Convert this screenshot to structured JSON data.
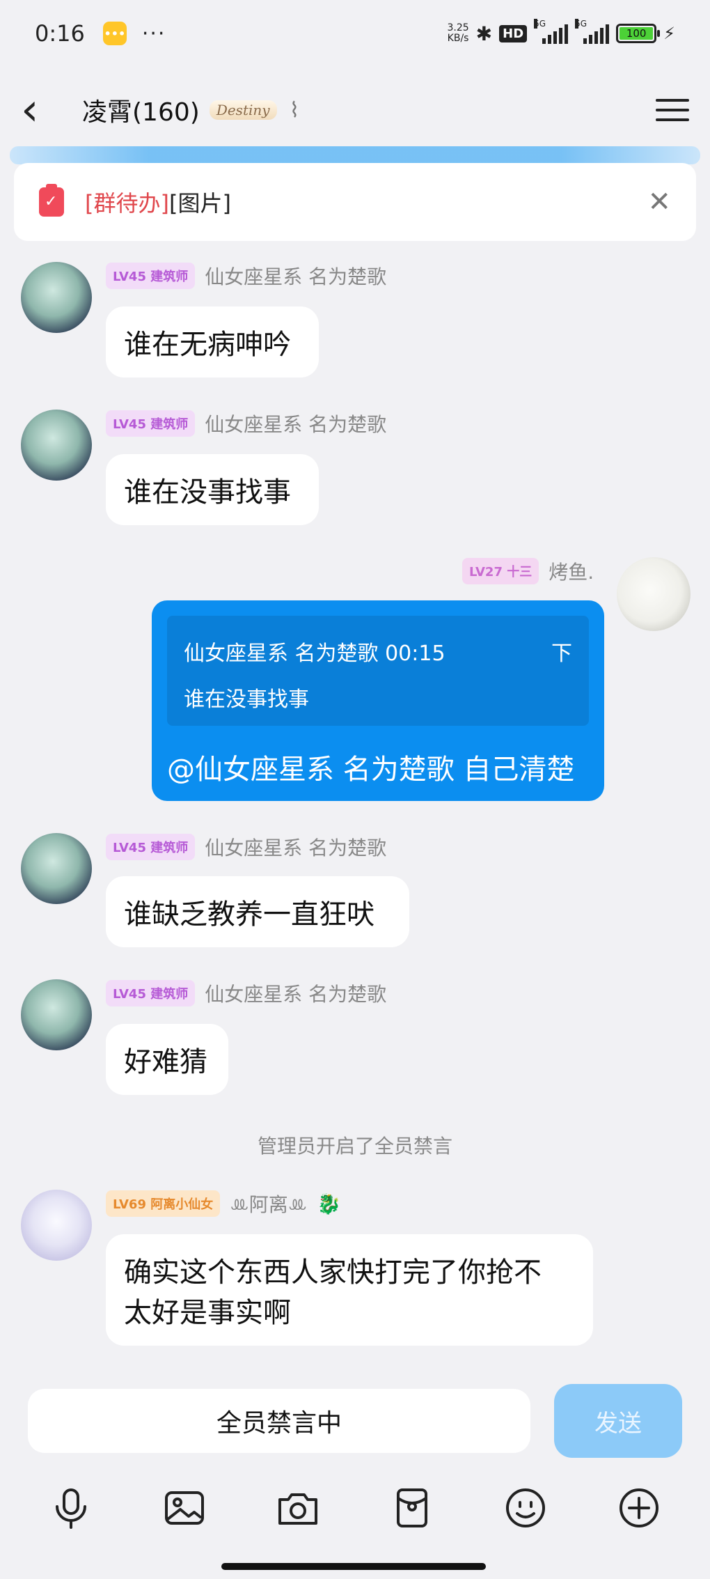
{
  "status_bar": {
    "time": "0:16",
    "menu_dots": "···",
    "net_speed_value": "3.25",
    "net_speed_unit": "KB/s",
    "hd_label": "HD",
    "signal_tag_1": "5G",
    "signal_tag_2": "5G",
    "battery_level": "100"
  },
  "header": {
    "title": "凌霄(160)",
    "badge_logo": "Destiny"
  },
  "todo_banner": {
    "tag": "[群待办]",
    "content": "[图片]"
  },
  "messages": [
    {
      "level": "LV45 建筑师",
      "sender": "仙女座星系 名为楚歌",
      "text": "谁在无病呻吟"
    },
    {
      "level": "LV45 建筑师",
      "sender": "仙女座星系 名为楚歌",
      "text": "谁在没事找事"
    },
    {
      "level": "LV45 建筑师",
      "sender": "仙女座星系 名为楚歌",
      "text": "谁缺乏教养一直狂吠"
    },
    {
      "level": "LV45 建筑师",
      "sender": "仙女座星系 名为楚歌",
      "text": "好难猜"
    },
    {
      "level": "LV69 阿离小仙女",
      "sender": "ꔛ阿离ꔛ",
      "text_line1": "确实这个东西人家快打完了你抢不",
      "text_line2": "太好是事实啊"
    }
  ],
  "my_message": {
    "level": "LV27 十三",
    "sender": "烤鱼.",
    "quote_header": "仙女座星系 名为楚歌 00:15",
    "quote_arrow": "下",
    "quote_text": "谁在没事找事",
    "text": "@仙女座星系 名为楚歌 自己清楚"
  },
  "system_note": "管理员开启了全员禁言",
  "input": {
    "status": "全员禁言中",
    "send_label": "发送"
  },
  "toolbar": {
    "icons": [
      "microphone-icon",
      "image-icon",
      "camera-icon",
      "red-packet-icon",
      "emoji-icon",
      "plus-icon"
    ]
  }
}
